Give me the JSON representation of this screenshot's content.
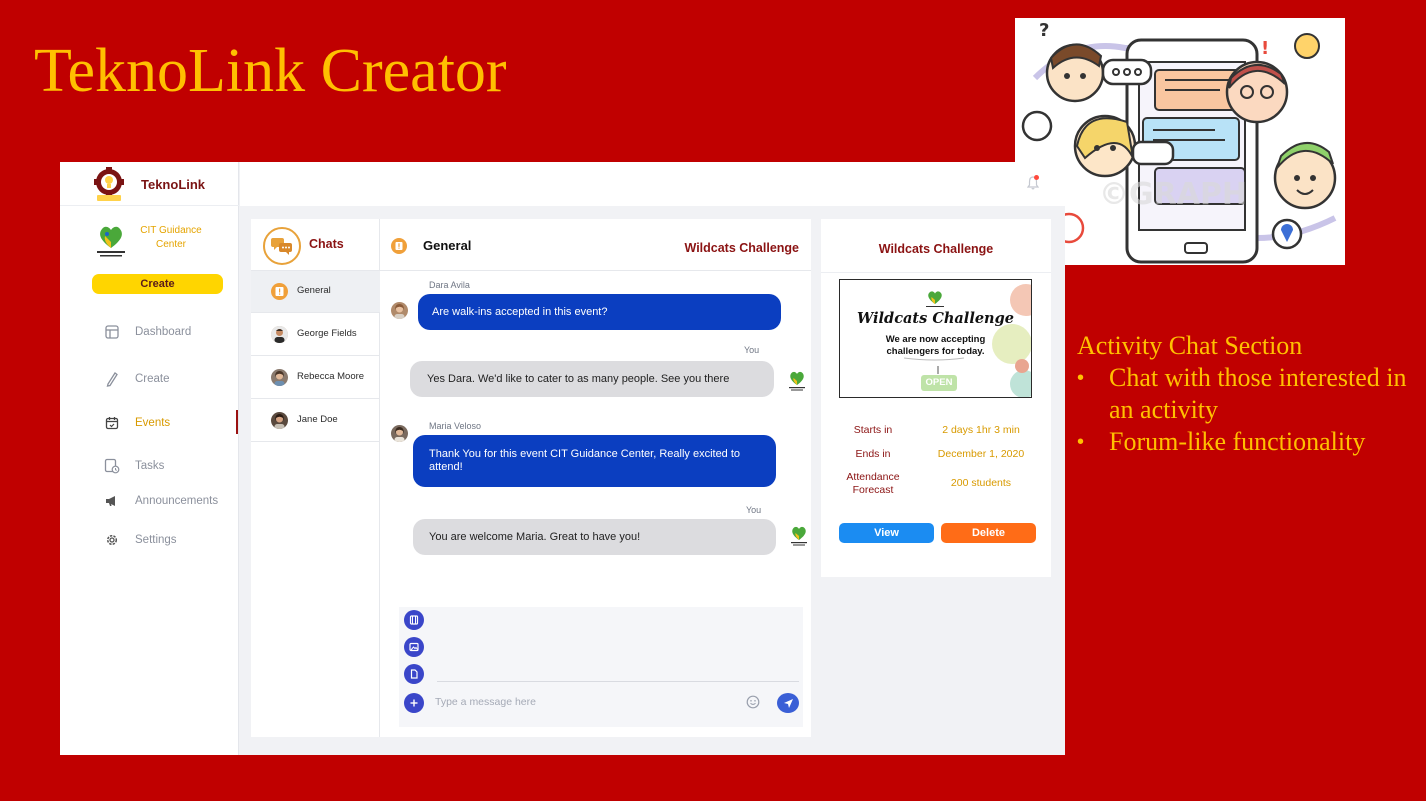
{
  "slide": {
    "title": "TeknoLink Creator",
    "notes_heading": "Activity Chat Section",
    "bullets": [
      "Chat with those interested in an activity",
      "Forum-like functionality"
    ],
    "colors": {
      "background": "#c00000",
      "text": "#ffc000"
    }
  },
  "app": {
    "brand": "TeknoLink",
    "org_name": "CIT Guidance Center",
    "create_label": "Create",
    "nav": [
      {
        "label": "Dashboard",
        "icon": "dashboard-icon"
      },
      {
        "label": "Create",
        "icon": "pencil-icon"
      },
      {
        "label": "Events",
        "icon": "calendar-icon",
        "active": true
      },
      {
        "label": "Tasks",
        "icon": "tasks-icon"
      },
      {
        "label": "Announcements",
        "icon": "megaphone-icon"
      },
      {
        "label": "Settings",
        "icon": "gear-icon"
      }
    ],
    "colors": {
      "accent": "#ffd500",
      "brand": "#8b1313",
      "active": "#d89a00",
      "bubble_in": "#0b3ec0",
      "bubble_out": "#dcdcdf"
    }
  },
  "chats": {
    "title": "Chats",
    "list": [
      {
        "name": "General"
      },
      {
        "name": "George Fields"
      },
      {
        "name": "Rebecca Moore"
      },
      {
        "name": "Jane Doe"
      }
    ]
  },
  "conversation": {
    "title": "General",
    "event": "Wildcats Challenge",
    "messages": [
      {
        "sender": "Dara Avila",
        "text": "Are walk-ins accepted in this event?",
        "direction": "in"
      },
      {
        "sender": "You",
        "text": "Yes Dara. We'd like to cater to as many people. See you there",
        "direction": "out"
      },
      {
        "sender": "Maria Veloso",
        "text": "Thank You for this event CIT Guidance Center, Really excited to attend!",
        "direction": "in"
      },
      {
        "sender": "You",
        "text": "You are welcome Maria. Great to have you!",
        "direction": "out"
      }
    ],
    "composer_placeholder": "Type a message here"
  },
  "event_detail": {
    "title": "Wildcats Challenge",
    "poster": {
      "title": "Wildcats Challenge",
      "subtitle_line1": "We are now accepting",
      "subtitle_line2": "challengers for today.",
      "sign": "OPEN"
    },
    "starts_label": "Starts in",
    "starts_value": "2 days 1hr 3 min",
    "ends_label": "Ends in",
    "ends_value": "December 1, 2020",
    "attendance_label_line1": "Attendance",
    "attendance_label_line2": "Forecast",
    "attendance_value": "200 students",
    "view_label": "View",
    "delete_label": "Delete"
  }
}
